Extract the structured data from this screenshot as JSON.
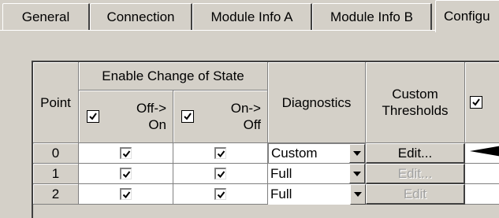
{
  "tabs": [
    {
      "label": "General"
    },
    {
      "label": "Connection"
    },
    {
      "label": "Module Info A"
    },
    {
      "label": "Module Info B"
    },
    {
      "label": "Configu"
    }
  ],
  "table": {
    "col_point": "Point",
    "col_enable_group": "Enable Change of State",
    "col_off_on": "Off->\nOn",
    "col_on_off": "On->\nOff",
    "col_diagnostics": "Diagnostics",
    "col_custom_thresholds": "Custom\nThresholds",
    "rows": [
      {
        "point": "0",
        "off_on": true,
        "on_off": true,
        "diagnostics": "Custom",
        "button": "Edit...",
        "button_enabled": true
      },
      {
        "point": "1",
        "off_on": true,
        "on_off": true,
        "diagnostics": "Full",
        "button": "Edit...",
        "button_enabled": false
      },
      {
        "point": "2",
        "off_on": true,
        "on_off": true,
        "diagnostics": "Full",
        "button": "Edit",
        "button_enabled": false
      }
    ]
  }
}
